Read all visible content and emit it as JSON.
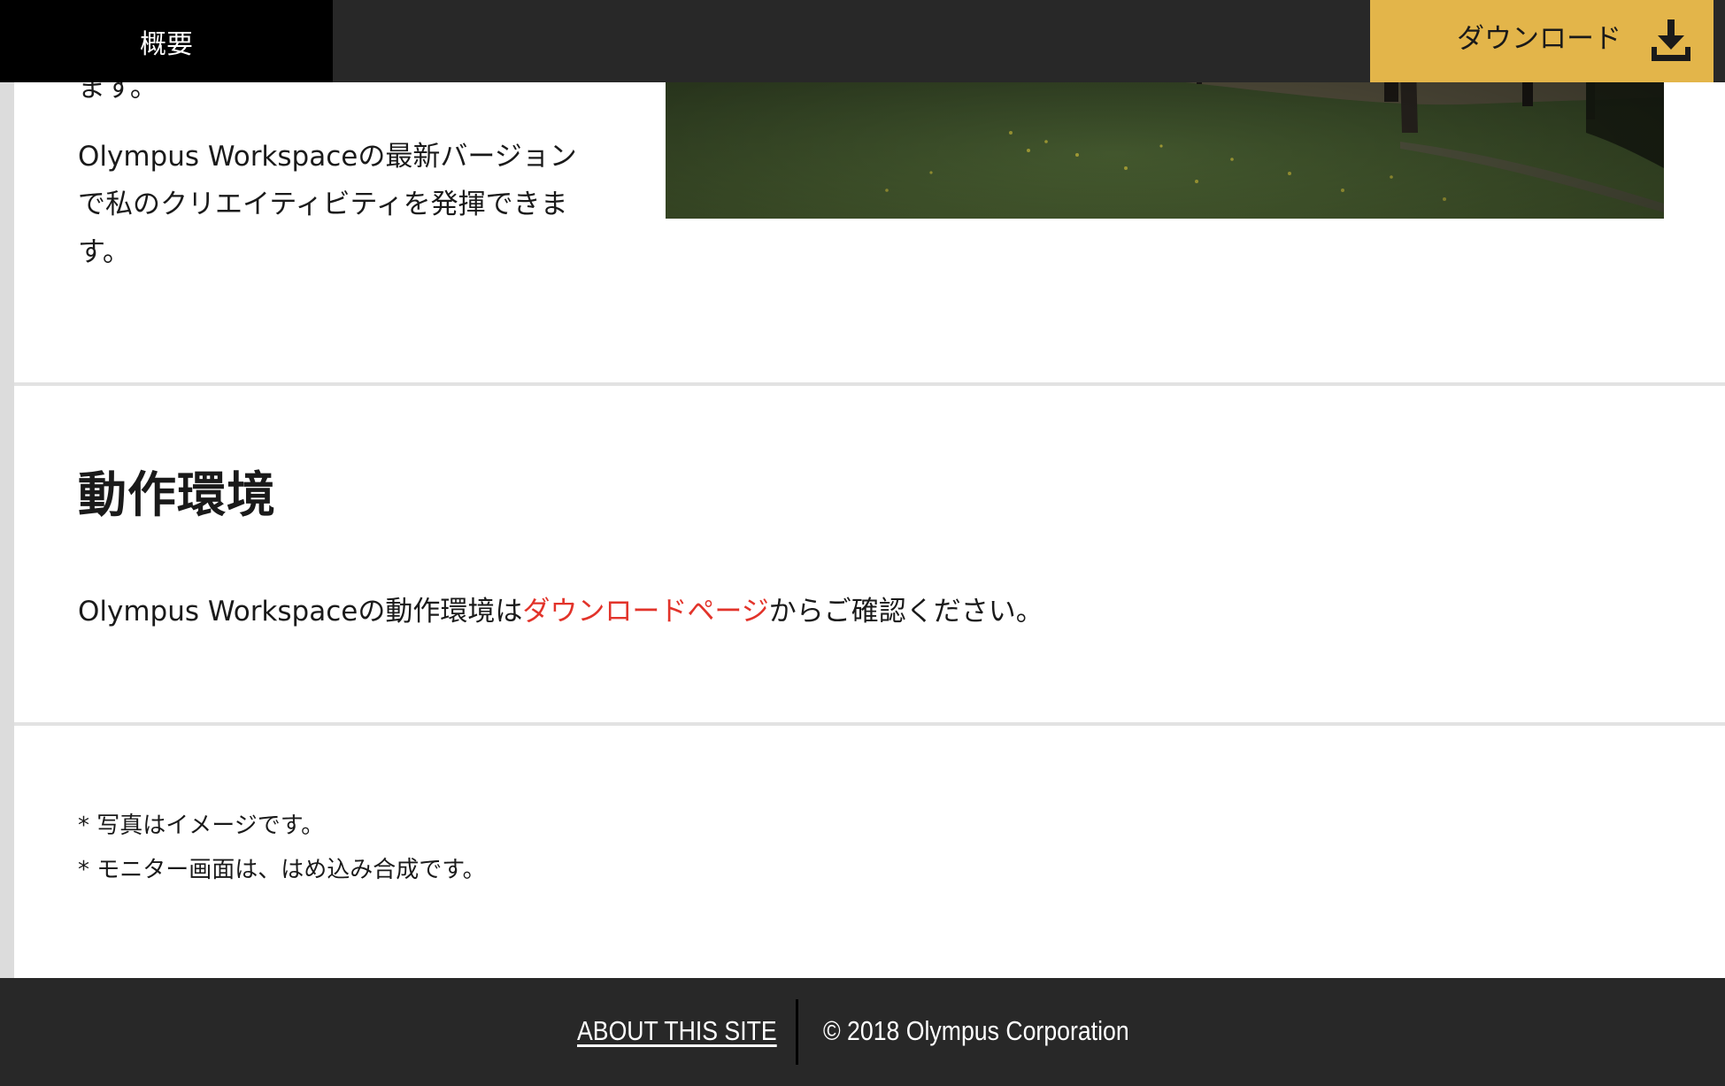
{
  "nav": {
    "overview_tab": "概要",
    "download_label": "ダウンロード",
    "download_icon": "download-icon"
  },
  "intro": {
    "cutoff_text": "ます。",
    "paragraph_lines": [
      "Olympus Workspaceの最新バージョン",
      "で私のクリエイティビティを発揮できま",
      "す。"
    ]
  },
  "environment": {
    "heading": "動作環境",
    "text_before": "Olympus Workspaceの動作環境は",
    "link_text": "ダウンロードページ",
    "text_after": "からご確認ください。"
  },
  "notes": [
    "* 写真はイメージです。",
    "* モニター画面は、はめ込み合成です。"
  ],
  "footer": {
    "about_link": "ABOUT THIS SITE",
    "copyright": "© 2018 Olympus Corporation"
  },
  "colors": {
    "nav_background": "#282828",
    "active_tab": "#000000",
    "download_button": "#e3b54a",
    "link": "#e2332a",
    "footer_background": "#282828"
  }
}
